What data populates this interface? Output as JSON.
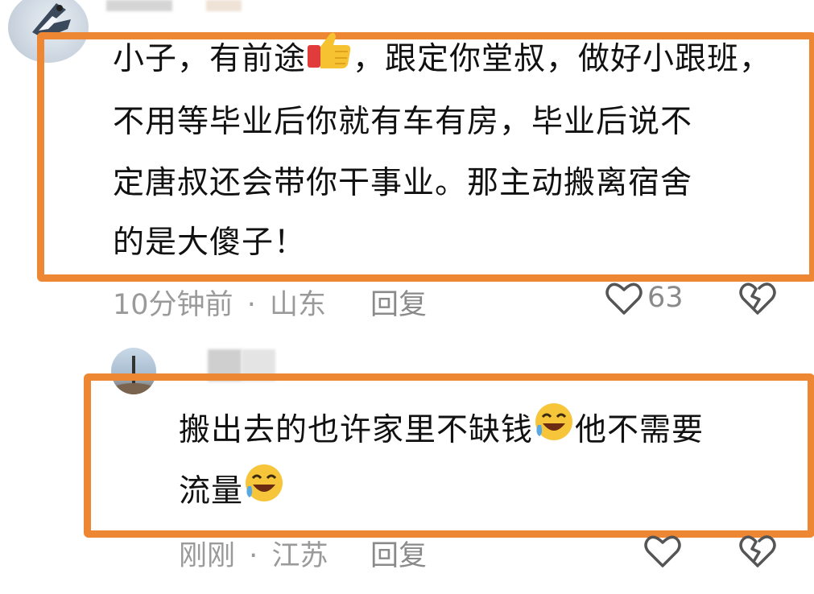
{
  "comments": [
    {
      "lines": [
        "小子，有前途",
        "，跟定你堂叔，做好小跟班，",
        "不用等毕业后你就有车有房，毕业后说不",
        "定唐叔还会带你干事业。那主动搬离宿舍",
        "的是大傻子！"
      ],
      "time": "10分钟前",
      "separator": "·",
      "location": "山东",
      "reply_label": "回复",
      "likes": "63",
      "emoji": "thumbs-up-icon"
    },
    {
      "lines": [
        "搬出去的也许家里不缺钱",
        "他不需要",
        "流量"
      ],
      "time": "刚刚",
      "separator": "·",
      "location": "江苏",
      "reply_label": "回复",
      "likes": "",
      "emoji": "laughing-crying-icon"
    }
  ],
  "colors": {
    "highlight": "#ee8733",
    "meta_text": "#9a9a9a"
  }
}
